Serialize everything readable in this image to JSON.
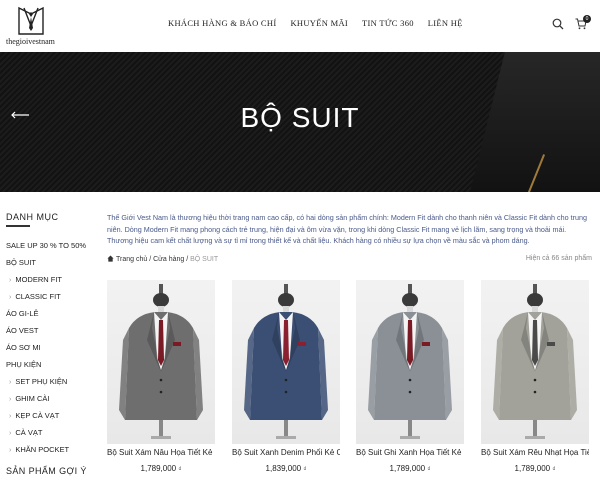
{
  "header": {
    "logo_text": "thegioivestnam",
    "nav": [
      "KHÁCH HÀNG & BÁO CHÍ",
      "KHUYẾN MÃI",
      "TIN TỨC 360",
      "LIÊN HỆ"
    ],
    "cart_count": "0"
  },
  "banner": {
    "title": "BỘ SUIT"
  },
  "sidebar": {
    "heading": "DANH MỤC",
    "items": [
      {
        "label": "SALE UP 30 % TO 50%",
        "sub": false
      },
      {
        "label": "BỘ SUIT",
        "sub": false
      },
      {
        "label": "MODERN FIT",
        "sub": true
      },
      {
        "label": "CLASSIC FIT",
        "sub": true
      },
      {
        "label": "ÁO GI-LÊ",
        "sub": false
      },
      {
        "label": "ÁO VEST",
        "sub": false
      },
      {
        "label": "ÁO SƠ MI",
        "sub": false
      },
      {
        "label": "PHỤ KIỆN",
        "sub": false
      },
      {
        "label": "SET PHỤ KIỆN",
        "sub": true
      },
      {
        "label": "GHIM CÀI",
        "sub": true
      },
      {
        "label": "KẸP CÀ VẠT",
        "sub": true
      },
      {
        "label": "CÀ VẠT",
        "sub": true
      },
      {
        "label": "KHĂN POCKET",
        "sub": true
      }
    ],
    "heading2": "SẢN PHẨM GỢI Ý"
  },
  "main": {
    "intro": "Thế Giới Vest Nam là thương hiệu thời trang nam cao cấp, có hai dòng sản phẩm chính: Modern Fit dành cho thanh niên và Classic Fit dành cho trung niên. Dòng Modern Fit mang phong cách trẻ trung, hiện đại và ôm vừa vặn, trong khi dòng Classic Fit mang vẻ lịch lãm, sang trọng và thoải mái. Thương hiệu cam kết chất lượng và sự tỉ mỉ trong thiết kế và chất liệu. Khách hàng có nhiều sự lựa chọn về màu sắc và phom dáng.",
    "breadcrumb": {
      "home": "Trang chủ",
      "shop": "Cửa hàng",
      "current": "BỘ SUIT"
    },
    "result_count": "Hiện cả 66 sản phẩm"
  },
  "products": [
    {
      "name": "Bộ Suit Xám Nâu Họa Tiết Kẻ C",
      "price": "1,789,000",
      "currency": "₫",
      "suit_color": "#6e6e6e",
      "tie_color": "#7a1a24"
    },
    {
      "name": "Bộ Suit Xanh Denim Phối Kẻ Ca",
      "price": "1,839,000",
      "currency": "₫",
      "suit_color": "#3b4f74",
      "tie_color": "#8a2030"
    },
    {
      "name": "Bộ Suit Ghi Xanh Họa Tiết Kẻ M",
      "price": "1,789,000",
      "currency": "₫",
      "suit_color": "#8a9096",
      "tie_color": "#7a1a24"
    },
    {
      "name": "Bộ Suit Xám Rêu Nhạt Họa Tiết",
      "price": "1,789,000",
      "currency": "₫",
      "suit_color": "#a2a29a",
      "tie_color": "#4a4a48"
    }
  ]
}
